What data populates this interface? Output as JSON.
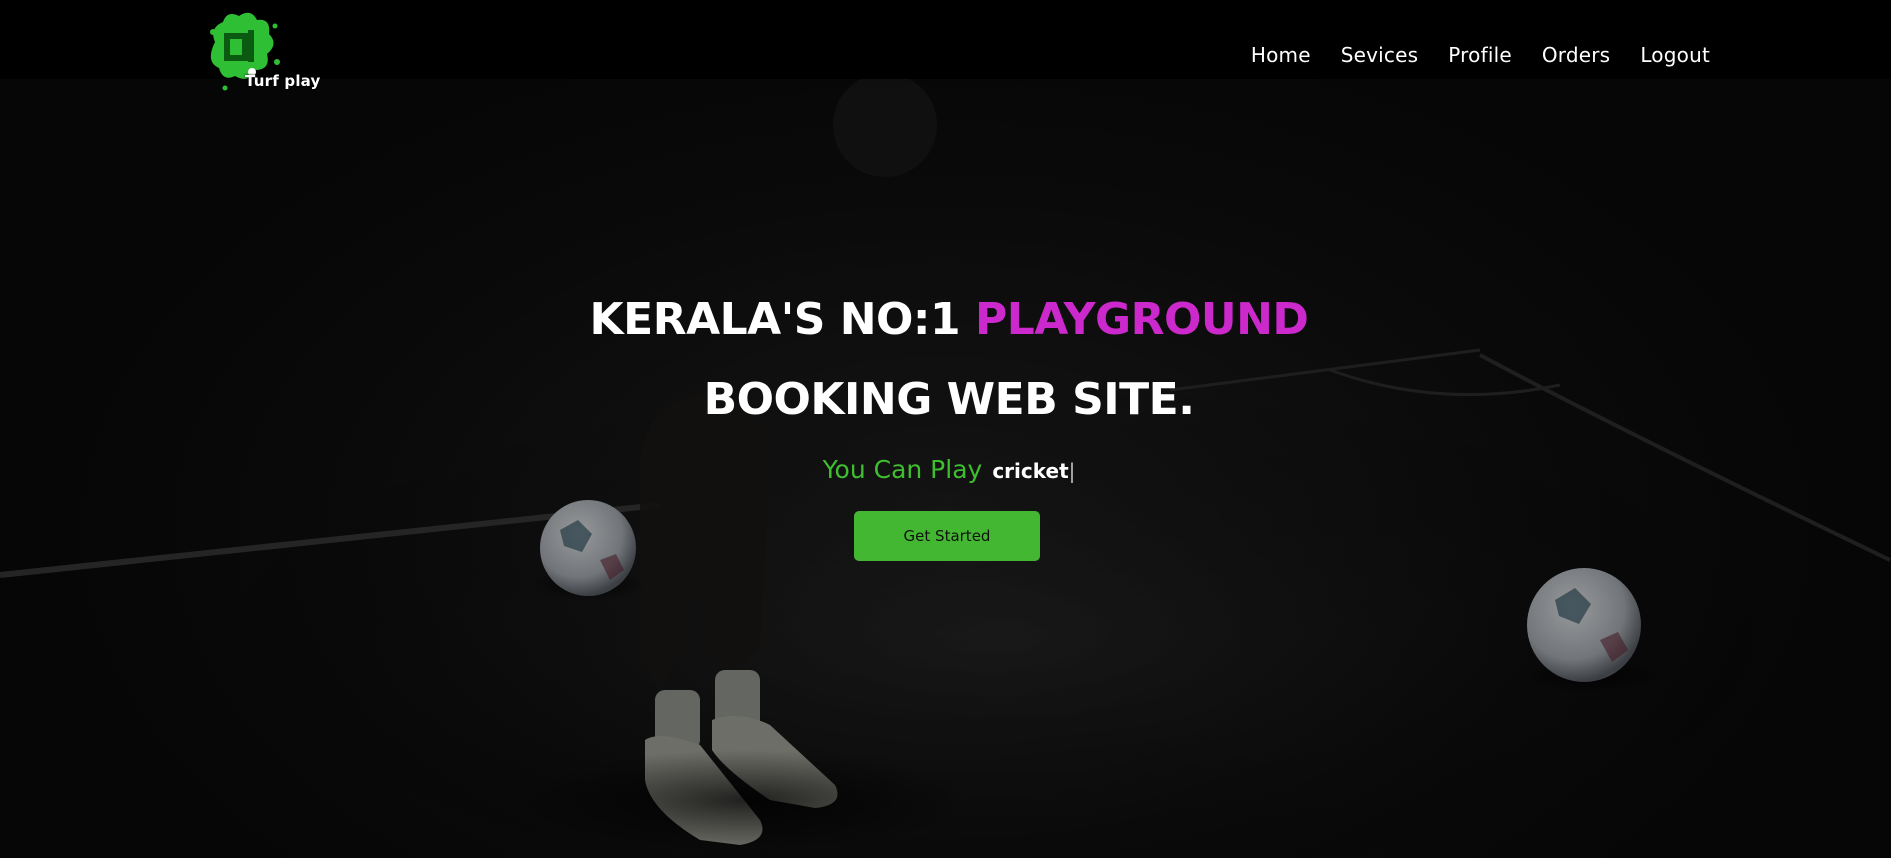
{
  "brand": {
    "logo_text": "Turf play",
    "logo_color": "#2fbf35"
  },
  "nav": {
    "items": [
      {
        "label": "Home"
      },
      {
        "label": "Sevices"
      },
      {
        "label": "Profile"
      },
      {
        "label": "Orders"
      },
      {
        "label": "Logout"
      }
    ]
  },
  "hero": {
    "headline_line1_part1": "KERALA'S NO:1 ",
    "headline_line1_accent": "PLAYGROUND",
    "headline_line2": "BOOKING WEB SITE.",
    "tagline_lead": "You Can Play",
    "tagline_typed": "cricket",
    "tagline_caret": "|",
    "cta_label": "Get Started"
  },
  "colors": {
    "accent_magenta": "#cc29cc",
    "accent_green": "#3fbf2f",
    "button_green": "#44b732",
    "header_bg": "#000000"
  }
}
